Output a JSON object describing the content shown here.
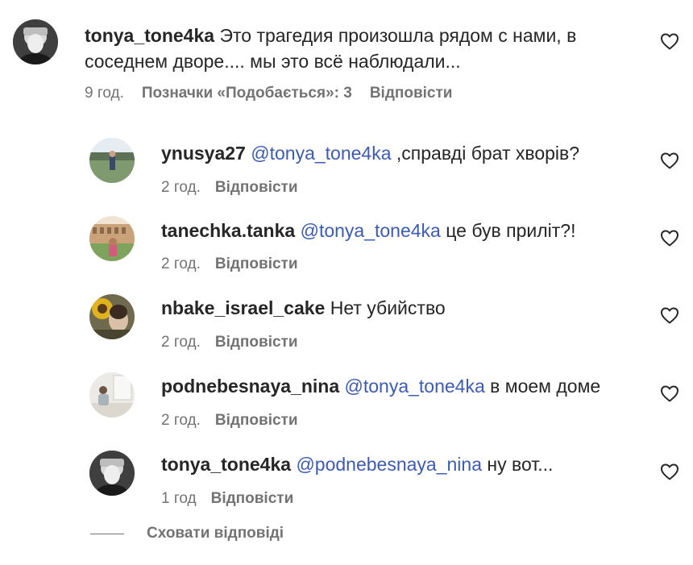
{
  "comments": [
    {
      "username": "tonya_tone4ka",
      "mention": "",
      "text": "Это трагедия произошла рядом с нами, в\nсоседнем дворе.... мы это всё наблюдали...",
      "time": "9 год.",
      "likes_label": "Позначки «Подобається»: 3",
      "reply_label": "Відповісти",
      "avatar_icon": "avatar-photo-bw",
      "like_icon": "heart-outline-icon"
    }
  ],
  "replies": [
    {
      "username": "ynusya27",
      "mention": "@tonya_tone4ka",
      "text": " ,справді брат хворів?",
      "time": "2 год.",
      "reply_label": "Відповісти",
      "avatar_icon": "avatar-photo-outdoor"
    },
    {
      "username": "tanechka.tanka",
      "mention": "@tonya_tone4ka",
      "text": " це був приліт?!",
      "time": "2 год.",
      "reply_label": "Відповісти",
      "avatar_icon": "avatar-photo-colosseum"
    },
    {
      "username": "nbake_israel_cake",
      "mention": "",
      "text": " Нет убийство",
      "time": "2 год.",
      "reply_label": "Відповісти",
      "avatar_icon": "avatar-photo-sunflower"
    },
    {
      "username": "podnebesnaya_nina",
      "mention": "@tonya_tone4ka",
      "text": " в моем доме",
      "time": "2 год.",
      "reply_label": "Відповісти",
      "avatar_icon": "avatar-photo-room"
    },
    {
      "username": "tonya_tone4ka",
      "mention": "@podnebesnaya_nina",
      "text": " ну вот...",
      "time": "1 год",
      "reply_label": "Відповісти",
      "avatar_icon": "avatar-photo-bw"
    }
  ],
  "hide_replies_label": "Сховати відповіді",
  "colors": {
    "text": "#262626",
    "muted": "#737373",
    "mention": "#3b5bb5"
  }
}
